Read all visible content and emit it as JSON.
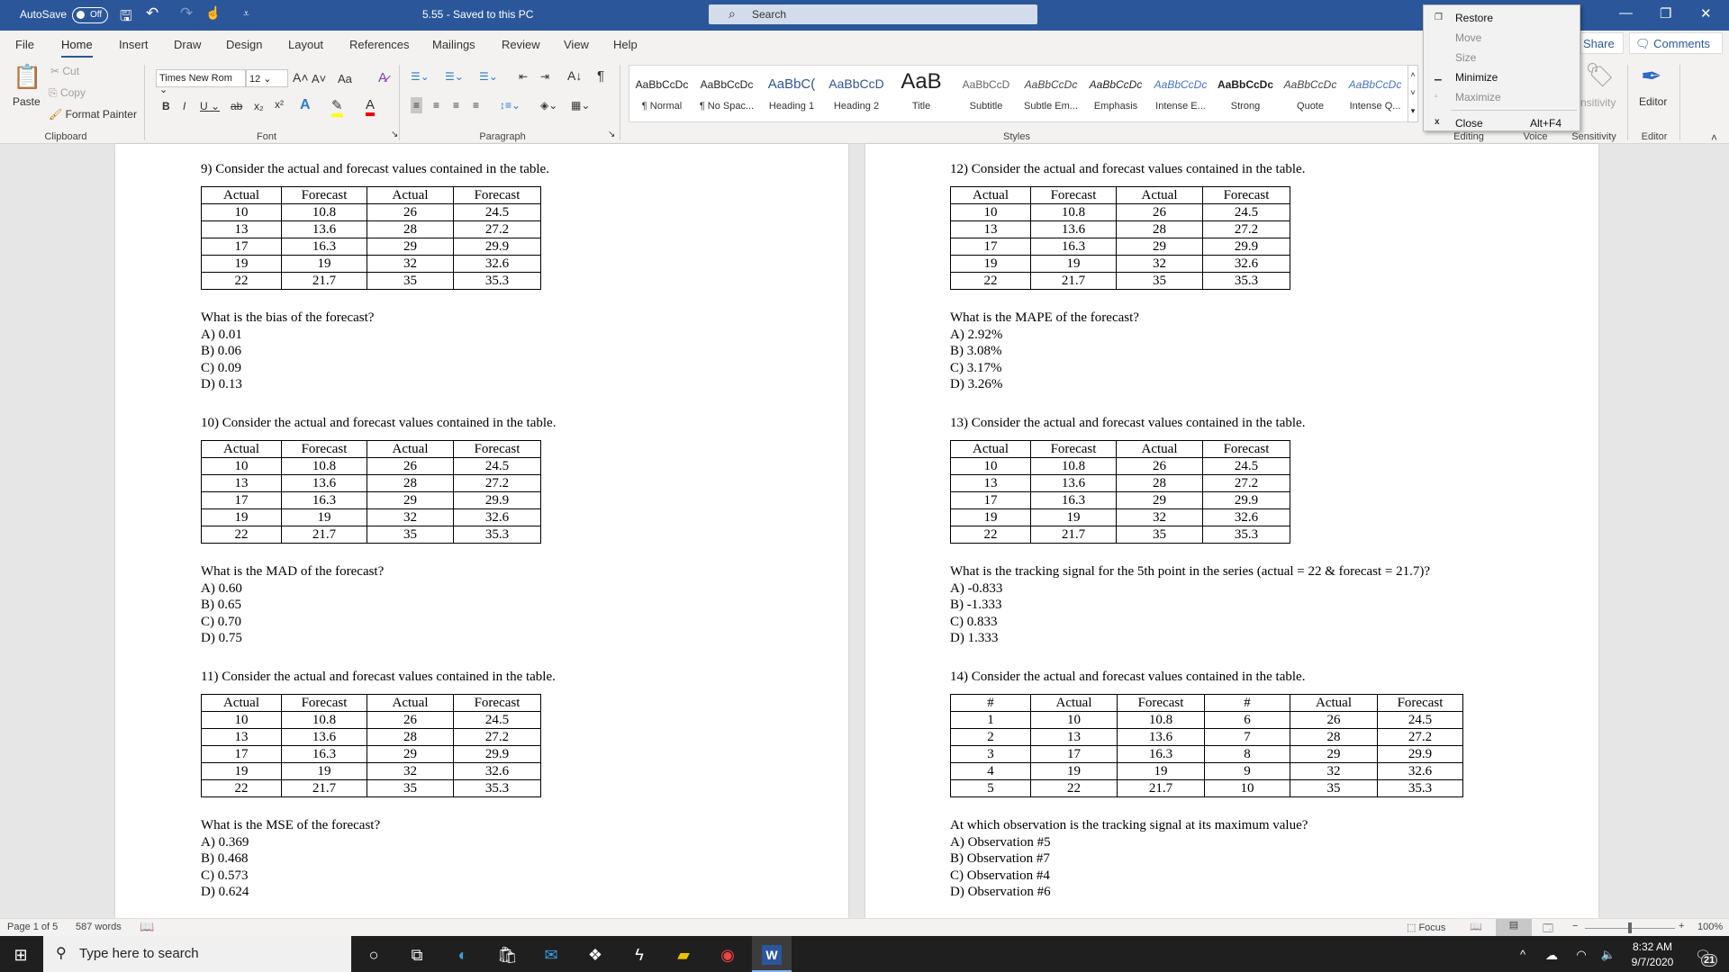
{
  "titlebar": {
    "autosave": "AutoSave",
    "autosave_state": "Off",
    "doc_title": "5.55  -  Saved to this PC",
    "search_placeholder": "Search"
  },
  "tabs": [
    "File",
    "Home",
    "Insert",
    "Draw",
    "Design",
    "Layout",
    "References",
    "Mailings",
    "Review",
    "View",
    "Help"
  ],
  "share": "Share",
  "comments": "Comments",
  "ribbon": {
    "clipboard": {
      "paste": "Paste",
      "cut": "Cut",
      "copy": "Copy",
      "format_painter": "Format Painter",
      "label": "Clipboard"
    },
    "font": {
      "name": "Times New Rom",
      "size": "12",
      "label": "Font",
      "case": "Aa"
    },
    "paragraph": {
      "label": "Paragraph"
    },
    "styles": {
      "label": "Styles",
      "items": [
        {
          "preview": "AaBbCcDc",
          "name": "¶ Normal"
        },
        {
          "preview": "AaBbCcDc",
          "name": "¶ No Spac..."
        },
        {
          "preview": "AaBbC(",
          "name": "Heading 1"
        },
        {
          "preview": "AaBbCcD",
          "name": "Heading 2"
        },
        {
          "preview": "AaB",
          "name": "Title"
        },
        {
          "preview": "AaBbCcD",
          "name": "Subtitle"
        },
        {
          "preview": "AaBbCcDc",
          "name": "Subtle Em..."
        },
        {
          "preview": "AaBbCcDc",
          "name": "Emphasis"
        },
        {
          "preview": "AaBbCcDc",
          "name": "Intense E..."
        },
        {
          "preview": "AaBbCcDc",
          "name": "Strong"
        },
        {
          "preview": "AaBbCcDc",
          "name": "Quote"
        },
        {
          "preview": "AaBbCcDc",
          "name": "Intense Q..."
        }
      ]
    },
    "editing": "Editing",
    "voice": "Voice",
    "sensitivity": "Sensitivity",
    "sensitivity_btn": "nsitivity",
    "editor": "Editor",
    "editor_label": "Editor"
  },
  "system_menu": {
    "restore": "Restore",
    "move": "Move",
    "size": "Size",
    "minimize": "Minimize",
    "maximize": "Maximize",
    "close": "Close",
    "close_shortcut": "Alt+F4"
  },
  "questions_left": [
    {
      "prompt": "9) Consider the actual and forecast values contained in the table.",
      "headers": [
        "Actual",
        "Forecast",
        "Actual",
        "Forecast"
      ],
      "rows": [
        [
          "10",
          "10.8",
          "26",
          "24.5"
        ],
        [
          "13",
          "13.6",
          "28",
          "27.2"
        ],
        [
          "17",
          "16.3",
          "29",
          "29.9"
        ],
        [
          "19",
          "19",
          "32",
          "32.6"
        ],
        [
          "22",
          "21.7",
          "35",
          "35.3"
        ]
      ],
      "question": "What is the bias of the forecast?",
      "options": [
        "A) 0.01",
        "B) 0.06",
        "C) 0.09",
        "D) 0.13"
      ]
    },
    {
      "prompt": "10) Consider the actual and forecast values contained in the table.",
      "headers": [
        "Actual",
        "Forecast",
        "Actual",
        "Forecast"
      ],
      "rows": [
        [
          "10",
          "10.8",
          "26",
          "24.5"
        ],
        [
          "13",
          "13.6",
          "28",
          "27.2"
        ],
        [
          "17",
          "16.3",
          "29",
          "29.9"
        ],
        [
          "19",
          "19",
          "32",
          "32.6"
        ],
        [
          "22",
          "21.7",
          "35",
          "35.3"
        ]
      ],
      "question": "What is the MAD of the forecast?",
      "options": [
        "A) 0.60",
        "B) 0.65",
        "C) 0.70",
        "D) 0.75"
      ]
    },
    {
      "prompt": "11) Consider the actual and forecast values contained in the table.",
      "headers": [
        "Actual",
        "Forecast",
        "Actual",
        "Forecast"
      ],
      "rows": [
        [
          "10",
          "10.8",
          "26",
          "24.5"
        ],
        [
          "13",
          "13.6",
          "28",
          "27.2"
        ],
        [
          "17",
          "16.3",
          "29",
          "29.9"
        ],
        [
          "19",
          "19",
          "32",
          "32.6"
        ],
        [
          "22",
          "21.7",
          "35",
          "35.3"
        ]
      ],
      "question": "What is the MSE of the forecast?",
      "options": [
        "A) 0.369",
        "B) 0.468",
        "C) 0.573",
        "D) 0.624"
      ]
    }
  ],
  "questions_right": [
    {
      "prompt": "12) Consider the actual and forecast values contained in the table.",
      "headers": [
        "Actual",
        "Forecast",
        "Actual",
        "Forecast"
      ],
      "rows": [
        [
          "10",
          "10.8",
          "26",
          "24.5"
        ],
        [
          "13",
          "13.6",
          "28",
          "27.2"
        ],
        [
          "17",
          "16.3",
          "29",
          "29.9"
        ],
        [
          "19",
          "19",
          "32",
          "32.6"
        ],
        [
          "22",
          "21.7",
          "35",
          "35.3"
        ]
      ],
      "question": "What is the MAPE of the forecast?",
      "options": [
        "A) 2.92%",
        "B) 3.08%",
        "C) 3.17%",
        "D) 3.26%"
      ]
    },
    {
      "prompt": "13) Consider the actual and forecast values contained in the table.",
      "headers": [
        "Actual",
        "Forecast",
        "Actual",
        "Forecast"
      ],
      "rows": [
        [
          "10",
          "10.8",
          "26",
          "24.5"
        ],
        [
          "13",
          "13.6",
          "28",
          "27.2"
        ],
        [
          "17",
          "16.3",
          "29",
          "29.9"
        ],
        [
          "19",
          "19",
          "32",
          "32.6"
        ],
        [
          "22",
          "21.7",
          "35",
          "35.3"
        ]
      ],
      "question": "What is the tracking signal for the 5th point in the series (actual = 22 & forecast = 21.7)?",
      "options": [
        "A) -0.833",
        "B) -1.333",
        "C) 0.833",
        "D) 1.333"
      ]
    },
    {
      "prompt": "14) Consider the actual and forecast values contained in the table.",
      "headers": [
        "#",
        "Actual",
        "Forecast",
        "#",
        "Actual",
        "Forecast"
      ],
      "rows": [
        [
          "1",
          "10",
          "10.8",
          "6",
          "26",
          "24.5"
        ],
        [
          "2",
          "13",
          "13.6",
          "7",
          "28",
          "27.2"
        ],
        [
          "3",
          "17",
          "16.3",
          "8",
          "29",
          "29.9"
        ],
        [
          "4",
          "19",
          "19",
          "9",
          "32",
          "32.6"
        ],
        [
          "5",
          "22",
          "21.7",
          "10",
          "35",
          "35.3"
        ]
      ],
      "question": "At which observation is the tracking signal at its maximum value?",
      "options": [
        "A) Observation #5",
        "B) Observation #7",
        "C) Observation #4",
        "D) Observation #6"
      ]
    }
  ],
  "statusbar": {
    "page": "Page 1 of 5",
    "words": "587 words",
    "focus": "Focus",
    "zoom": "100%",
    "zoom_level_percent": 100
  },
  "taskbar": {
    "search_placeholder": "Type here to search",
    "time": "8:32 AM",
    "date": "9/7/2020",
    "notifications": "21"
  },
  "colors": {
    "word_blue": "#2b579a",
    "taskbar": "#1f1f1f"
  }
}
